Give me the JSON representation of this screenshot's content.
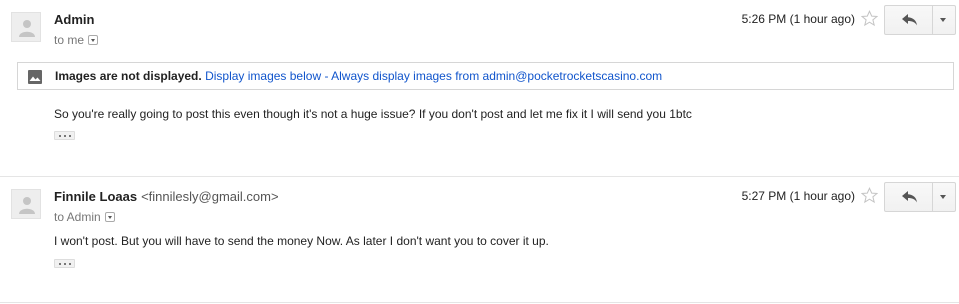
{
  "messages": [
    {
      "sender_name": "Admin",
      "sender_email": "",
      "recipient": "to me",
      "time": "5:26 PM (1 hour ago)",
      "body": "So you're really going to post this even though it's not a huge issue? If you don't post and let me fix it I will send you 1btc"
    },
    {
      "sender_name": "Finnile Loaas",
      "sender_email": "<finnilesly@gmail.com>",
      "recipient": "to Admin",
      "time": "5:27 PM (1 hour ago)",
      "body": "I won't post. But you will have to send the money Now. As later I don't want you to cover it up."
    }
  ],
  "images_banner": {
    "notice": "Images are not displayed.",
    "display_below": "Display images below",
    "separator": " - ",
    "always_display": "Always display images from admin@pocketrocketscasino.com"
  },
  "colors": {
    "link": "#1155cc",
    "divider": "#e5e5e5"
  },
  "icons": [
    "avatar-icon",
    "star-icon",
    "reply-icon",
    "chevron-down-icon",
    "image-icon",
    "ellipsis-icon"
  ]
}
